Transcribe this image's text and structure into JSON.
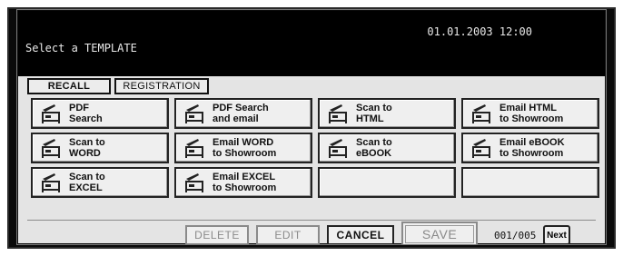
{
  "header": {
    "prompt": "Select a TEMPLATE",
    "datetime": "01.01.2003 12:00"
  },
  "tabs": [
    {
      "label": "RECALL"
    },
    {
      "label": "REGISTRATION"
    }
  ],
  "templates": [
    {
      "label": "PDF\nSearch",
      "icon": "scanner-icon"
    },
    {
      "label": "PDF Search\nand email",
      "icon": "scanner-icon"
    },
    {
      "label": "Scan to\nHTML",
      "icon": "scanner-icon"
    },
    {
      "label": "Email HTML\nto Showroom",
      "icon": "scanner-icon"
    },
    {
      "label": "Scan to\nWORD",
      "icon": "scanner-icon"
    },
    {
      "label": "Email WORD\nto Showroom",
      "icon": "scanner-icon"
    },
    {
      "label": "Scan to\neBOOK",
      "icon": "scanner-icon"
    },
    {
      "label": "Email eBOOK\nto Showroom",
      "icon": "scanner-icon"
    },
    {
      "label": "Scan to\nEXCEL",
      "icon": "scanner-icon"
    },
    {
      "label": "Email EXCEL\nto Showroom",
      "icon": "scanner-icon"
    },
    {
      "label": ""
    },
    {
      "label": ""
    }
  ],
  "footer": {
    "delete_label": "DELETE",
    "edit_label": "EDIT",
    "cancel_label": "CANCEL",
    "save_label": "SAVE",
    "page_indicator": "001/005",
    "next_label": "Next"
  }
}
